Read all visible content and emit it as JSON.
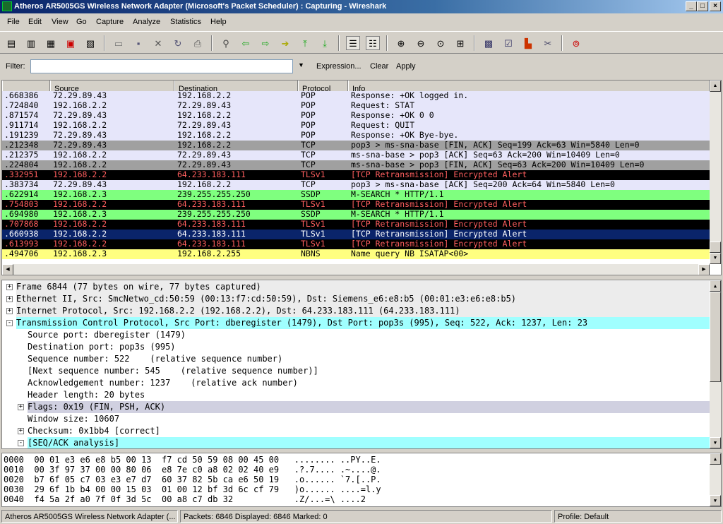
{
  "window": {
    "title": "Atheros AR5005GS Wireless Network Adapter (Microsoft's Packet Scheduler) : Capturing - Wireshark",
    "controls": [
      "_",
      "□",
      "×"
    ]
  },
  "menu": [
    "File",
    "Edit",
    "View",
    "Go",
    "Capture",
    "Analyze",
    "Statistics",
    "Help"
  ],
  "toolbar": {
    "icons": [
      "interfaces-icon",
      "options-icon",
      "start-icon",
      "stop-icon",
      "restart-icon",
      "open-icon",
      "save-icon",
      "close-icon",
      "reload-icon",
      "print-icon",
      "find-icon",
      "back-icon",
      "forward-icon",
      "goto-icon",
      "first-icon",
      "last-icon",
      "colorize-icon",
      "autoscroll-icon",
      "zoom-in-icon",
      "zoom-out-icon",
      "zoom-normal-icon",
      "resize-columns-icon",
      "capture-filters-icon",
      "display-filters-icon",
      "coloring-rules-icon",
      "preferences-icon",
      "help-icon"
    ]
  },
  "filter": {
    "label": "Filter:",
    "value": "",
    "expression_label": "Expression...",
    "clear_label": "Clear",
    "apply_label": "Apply"
  },
  "packet_list": {
    "columns": [
      "",
      "Source",
      "Destination",
      "Protocol",
      "Info"
    ],
    "rows": [
      {
        "time": ".668386",
        "src": "72.29.89.43",
        "dst": "192.168.2.2",
        "proto": "POP",
        "info": "Response: +OK logged in.",
        "bg": "#e6e6fa",
        "fg": "#000000"
      },
      {
        "time": ".724840",
        "src": "192.168.2.2",
        "dst": "72.29.89.43",
        "proto": "POP",
        "info": "Request: STAT",
        "bg": "#e6e6fa",
        "fg": "#000000"
      },
      {
        "time": ".871574",
        "src": "72.29.89.43",
        "dst": "192.168.2.2",
        "proto": "POP",
        "info": "Response: +OK 0 0",
        "bg": "#e6e6fa",
        "fg": "#000000"
      },
      {
        "time": ".911714",
        "src": "192.168.2.2",
        "dst": "72.29.89.43",
        "proto": "POP",
        "info": "Request: QUIT",
        "bg": "#e6e6fa",
        "fg": "#000000"
      },
      {
        "time": ".191239",
        "src": "72.29.89.43",
        "dst": "192.168.2.2",
        "proto": "POP",
        "info": "Response: +OK Bye-bye.",
        "bg": "#e6e6fa",
        "fg": "#000000"
      },
      {
        "time": ".212348",
        "src": "72.29.89.43",
        "dst": "192.168.2.2",
        "proto": "TCP",
        "info": "pop3 > ms-sna-base [FIN, ACK] Seq=199 Ack=63 Win=5840 Len=0",
        "bg": "#a0a0a0",
        "fg": "#000000"
      },
      {
        "time": ".212375",
        "src": "192.168.2.2",
        "dst": "72.29.89.43",
        "proto": "TCP",
        "info": "ms-sna-base > pop3 [ACK] Seq=63 Ack=200 Win=10409 Len=0",
        "bg": "#e6e6fa",
        "fg": "#000000"
      },
      {
        "time": ".224804",
        "src": "192.168.2.2",
        "dst": "72.29.89.43",
        "proto": "TCP",
        "info": "ms-sna-base > pop3 [FIN, ACK] Seq=63 Ack=200 Win=10409 Len=0",
        "bg": "#a0a0a0",
        "fg": "#000000"
      },
      {
        "time": ".332951",
        "src": "192.168.2.2",
        "dst": "64.233.183.111",
        "proto": "TLSv1",
        "info": "[TCP Retransmission] Encrypted Alert",
        "bg": "#000000",
        "fg": "#ff5f5f"
      },
      {
        "time": ".383734",
        "src": "72.29.89.43",
        "dst": "192.168.2.2",
        "proto": "TCP",
        "info": "pop3 > ms-sna-base [ACK] Seq=200 Ack=64 Win=5840 Len=0",
        "bg": "#e6e6fa",
        "fg": "#000000"
      },
      {
        "time": ".622914",
        "src": "192.168.2.3",
        "dst": "239.255.255.250",
        "proto": "SSDP",
        "info": "M-SEARCH * HTTP/1.1",
        "bg": "#7fff7f",
        "fg": "#000000"
      },
      {
        "time": ".754803",
        "src": "192.168.2.2",
        "dst": "64.233.183.111",
        "proto": "TLSv1",
        "info": "[TCP Retransmission] Encrypted Alert",
        "bg": "#000000",
        "fg": "#ff5f5f"
      },
      {
        "time": ".694980",
        "src": "192.168.2.3",
        "dst": "239.255.255.250",
        "proto": "SSDP",
        "info": "M-SEARCH * HTTP/1.1",
        "bg": "#7fff7f",
        "fg": "#000000"
      },
      {
        "time": ".707868",
        "src": "192.168.2.2",
        "dst": "64.233.183.111",
        "proto": "TLSv1",
        "info": "[TCP Retransmission] Encrypted Alert",
        "bg": "#000000",
        "fg": "#ff5f5f"
      },
      {
        "time": ".660938",
        "src": "192.168.2.2",
        "dst": "64.233.183.111",
        "proto": "TLSv1",
        "info": "[TCP Retransmission] Encrypted Alert",
        "bg": "#0a246a",
        "fg": "#ffffff"
      },
      {
        "time": ".613993",
        "src": "192.168.2.2",
        "dst": "64.233.183.111",
        "proto": "TLSv1",
        "info": "[TCP Retransmission] Encrypted Alert",
        "bg": "#000000",
        "fg": "#ff5f5f"
      },
      {
        "time": ".494706",
        "src": "192.168.2.3",
        "dst": "192.168.2.255",
        "proto": "NBNS",
        "info": "Name query NB ISATAP<00>",
        "bg": "#ffff80",
        "fg": "#000000"
      }
    ]
  },
  "details": [
    {
      "indent": 0,
      "toggle": "+",
      "text": "Frame 6844 (77 bytes on wire, 77 bytes captured)",
      "bg": "#ececec"
    },
    {
      "indent": 0,
      "toggle": "+",
      "text": "Ethernet II, Src: SmcNetwo_cd:50:59 (00:13:f7:cd:50:59), Dst: Siemens_e6:e8:b5 (00:01:e3:e6:e8:b5)",
      "bg": "#ececec"
    },
    {
      "indent": 0,
      "toggle": "+",
      "text": "Internet Protocol, Src: 192.168.2.2 (192.168.2.2), Dst: 64.233.183.111 (64.233.183.111)",
      "bg": "#ececec"
    },
    {
      "indent": 0,
      "toggle": "-",
      "text": "Transmission Control Protocol, Src Port: dberegister (1479), Dst Port: pop3s (995), Seq: 522, Ack: 1237, Len: 23",
      "bg": "#a0ffff"
    },
    {
      "indent": 1,
      "toggle": "",
      "text": "Source port: dberegister (1479)",
      "bg": "#ffffff"
    },
    {
      "indent": 1,
      "toggle": "",
      "text": "Destination port: pop3s (995)",
      "bg": "#ffffff"
    },
    {
      "indent": 1,
      "toggle": "",
      "text": "Sequence number: 522    (relative sequence number)",
      "bg": "#ffffff"
    },
    {
      "indent": 1,
      "toggle": "",
      "text": "[Next sequence number: 545    (relative sequence number)]",
      "bg": "#ffffff"
    },
    {
      "indent": 1,
      "toggle": "",
      "text": "Acknowledgement number: 1237    (relative ack number)",
      "bg": "#ffffff"
    },
    {
      "indent": 1,
      "toggle": "",
      "text": "Header length: 20 bytes",
      "bg": "#ffffff"
    },
    {
      "indent": 1,
      "toggle": "+",
      "text": "Flags: 0x19 (FIN, PSH, ACK)",
      "bg": "#d0d0e0"
    },
    {
      "indent": 1,
      "toggle": "",
      "text": "Window size: 10607",
      "bg": "#ffffff"
    },
    {
      "indent": 1,
      "toggle": "+",
      "text": "Checksum: 0x1bb4 [correct]",
      "bg": "#ffffff"
    },
    {
      "indent": 1,
      "toggle": "-",
      "text": "[SEQ/ACK analysis]",
      "bg": "#a0ffff"
    }
  ],
  "bytes": [
    "0000  00 01 e3 e6 e8 b5 00 13  f7 cd 50 59 08 00 45 00   ........ ..PY..E.",
    "0010  00 3f 97 37 00 00 80 06  e8 7e c0 a8 02 02 40 e9   .?.7.... .~....@.",
    "0020  b7 6f 05 c7 03 e3 e7 d7  60 37 82 5b ca e6 50 19   .o...... `7.[..P.",
    "0030  29 6f 1b b4 00 00 15 03  01 00 12 bf 3d 6c cf 79   )o...... ....=l.y",
    "0040  f4 5a 2f a0 7f 0f 3d 5c  00 a8 c7 db 32            .Z/...=\\ ....2"
  ],
  "status": {
    "interface": "Atheros AR5005GS Wireless Network Adapter (...",
    "packets": "Packets: 6846 Displayed: 6846 Marked: 0",
    "profile": "Profile: Default"
  }
}
